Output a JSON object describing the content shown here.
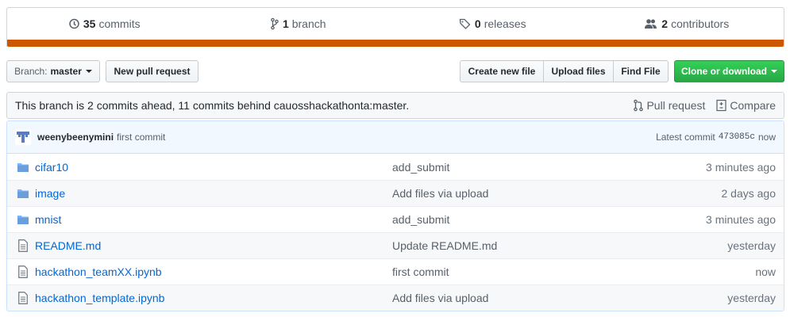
{
  "summary": {
    "commits": {
      "count": "35",
      "label": "commits"
    },
    "branches": {
      "count": "1",
      "label": "branch"
    },
    "releases": {
      "count": "0",
      "label": "releases"
    },
    "contributors": {
      "count": "2",
      "label": "contributors"
    }
  },
  "colors": {
    "language_bar": "#cc5700",
    "link": "#0366d6",
    "green_button": "#28a745"
  },
  "toolbar": {
    "branch_prefix": "Branch:",
    "branch_name": "master",
    "new_pull_request": "New pull request",
    "create_new_file": "Create new file",
    "upload_files": "Upload files",
    "find_file": "Find File",
    "clone_or_download": "Clone or download"
  },
  "branch_info": {
    "message": "This branch is 2 commits ahead, 11 commits behind cauosshackathonta:master.",
    "pull_request": "Pull request",
    "compare": "Compare"
  },
  "latest_commit": {
    "author": "weenybeenymini",
    "message": "first commit",
    "label": "Latest commit",
    "sha": "473085c",
    "age": "now"
  },
  "files": [
    {
      "type": "folder",
      "icon": "folder-icon",
      "name": "cifar10",
      "message": "add_submit",
      "age": "3 minutes ago"
    },
    {
      "type": "folder",
      "icon": "folder-icon",
      "name": "image",
      "message": "Add files via upload",
      "age": "2 days ago"
    },
    {
      "type": "folder",
      "icon": "folder-icon",
      "name": "mnist",
      "message": "add_submit",
      "age": "3 minutes ago"
    },
    {
      "type": "file",
      "icon": "file-icon",
      "name": "README.md",
      "message": "Update README.md",
      "age": "yesterday"
    },
    {
      "type": "file",
      "icon": "file-icon",
      "name": "hackathon_teamXX.ipynb",
      "message": "first commit",
      "age": "now"
    },
    {
      "type": "file",
      "icon": "file-icon",
      "name": "hackathon_template.ipynb",
      "message": "Add files via upload",
      "age": "yesterday"
    }
  ]
}
